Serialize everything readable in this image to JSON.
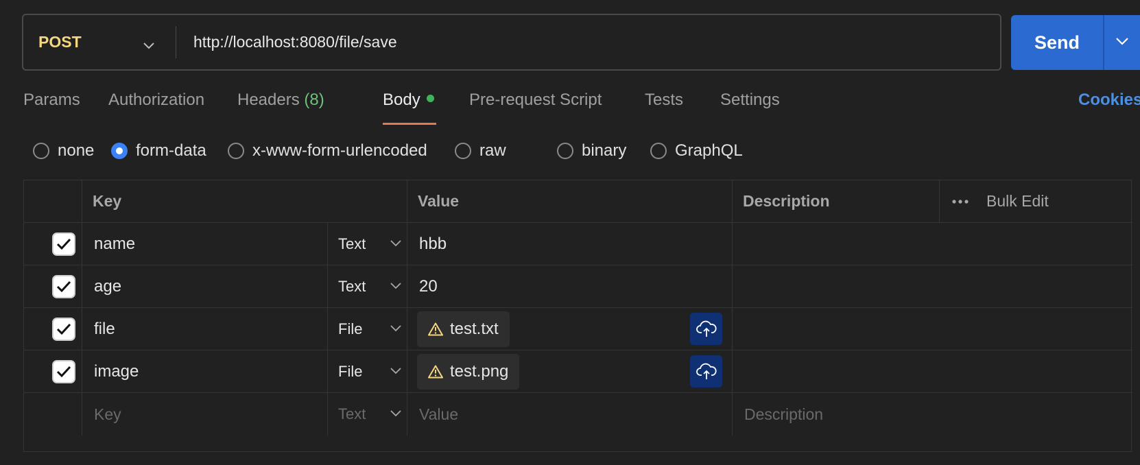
{
  "request": {
    "method": "POST",
    "url": "http://localhost:8080/file/save",
    "send_label": "Send"
  },
  "tabs": [
    {
      "label": "Params"
    },
    {
      "label": "Authorization"
    },
    {
      "label": "Headers",
      "count": "(8)"
    },
    {
      "label": "Body",
      "active": true
    },
    {
      "label": "Pre-request Script"
    },
    {
      "label": "Tests"
    },
    {
      "label": "Settings"
    }
  ],
  "cookies_label": "Cookies",
  "body_types": [
    {
      "label": "none",
      "checked": false
    },
    {
      "label": "form-data",
      "checked": true
    },
    {
      "label": "x-www-form-urlencoded",
      "checked": false
    },
    {
      "label": "raw",
      "checked": false
    },
    {
      "label": "binary",
      "checked": false
    },
    {
      "label": "GraphQL",
      "checked": false
    }
  ],
  "table": {
    "headers": {
      "key": "Key",
      "value": "Value",
      "description": "Description",
      "bulk_edit": "Bulk Edit"
    },
    "rows": [
      {
        "key": "name",
        "type": "Text",
        "value": "hbb",
        "checked": true
      },
      {
        "key": "age",
        "type": "Text",
        "value": "20",
        "checked": true
      },
      {
        "key": "file",
        "type": "File",
        "value": "test.txt",
        "checked": true
      },
      {
        "key": "image",
        "type": "File",
        "value": "test.png",
        "checked": true
      }
    ],
    "new_row": {
      "key_placeholder": "Key",
      "type": "Text",
      "value_placeholder": "Value",
      "description_placeholder": "Description"
    }
  },
  "colors": {
    "method": "#f6d77e",
    "send": "#2b6ad1",
    "active_tab_underline": "#e8774d",
    "body_dot": "#3fb35a",
    "headers_count": "#6cc27a",
    "cookies": "#4d8fe3",
    "upload_button": "#0f3173",
    "warning": "#f6d77e"
  },
  "icons": {
    "method_dropdown": "chevron-down-icon",
    "send_dropdown": "chevron-down-icon",
    "checkbox": "check-icon",
    "file_warning": "warning-icon",
    "upload": "cloud-upload-icon",
    "more": "more-horizontal-icon"
  }
}
